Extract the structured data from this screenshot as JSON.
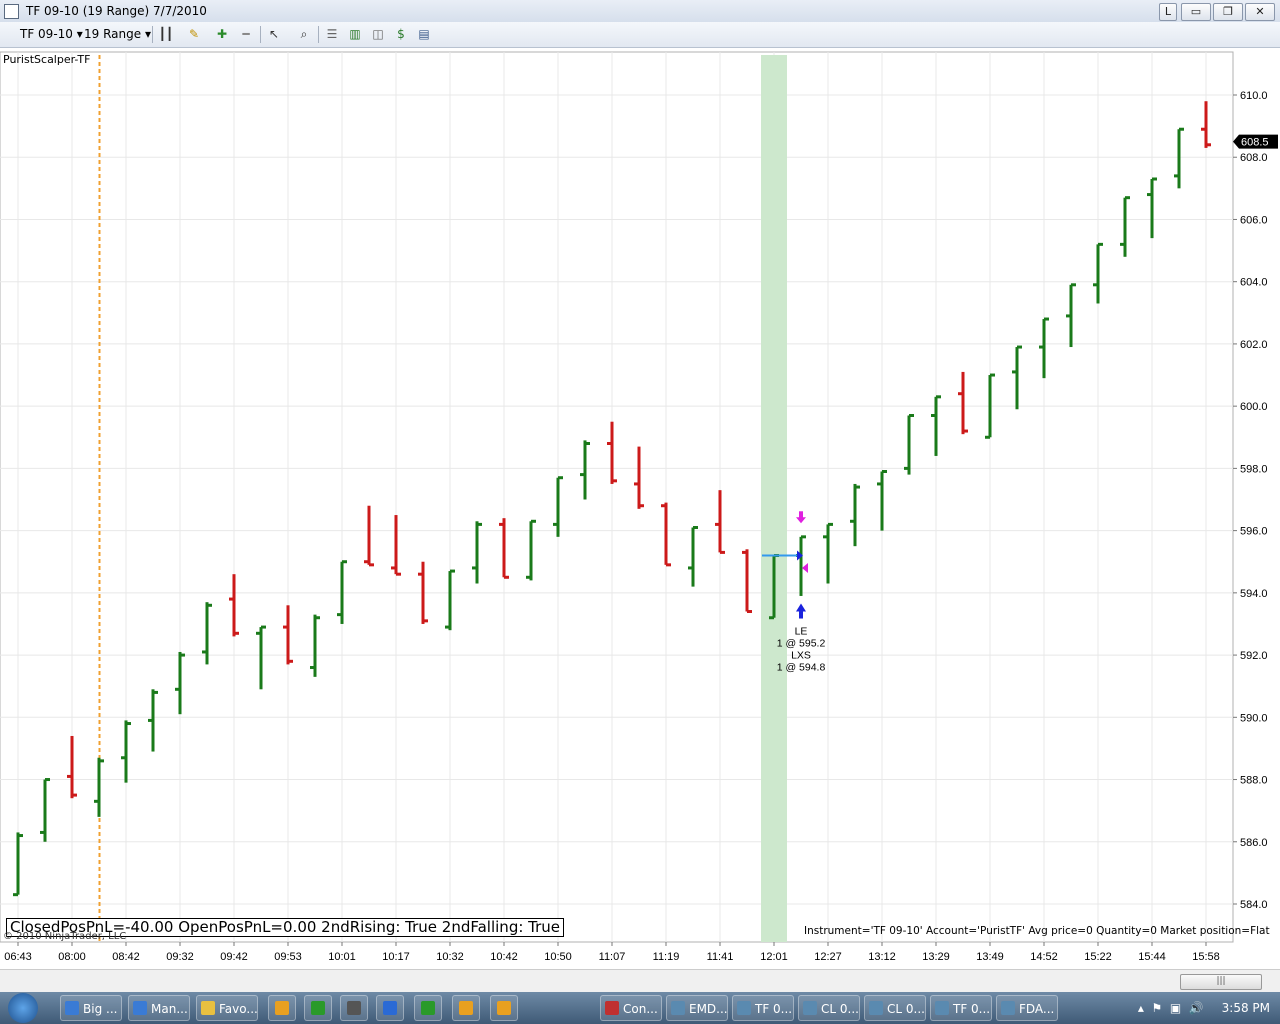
{
  "window": {
    "title": "TF 09-10 (19 Range)  7/7/2010",
    "buttons": [
      "L",
      "▭",
      "❐",
      "✕"
    ]
  },
  "toolbar": {
    "instrument": "TF 09-10",
    "period": "19 Range"
  },
  "pane_label": "PuristScalper-TF",
  "status_text": "ClosedPosPnL=-40.00 OpenPosPnL=0.00 2ndRising: True 2ndFalling: True",
  "copyright": "© 2010 NinjaTrader, LLC",
  "instrument_info": "Instrument='TF 09-10' Account='PuristTF' Avg price=0 Quantity=0 Market position=Flat",
  "colors": {
    "up": "#1a7a1a",
    "down": "#cc1a1a",
    "highlight": "#cde8cd",
    "session_line": "#f0a030",
    "entry_arrow": "#1a22dd",
    "exit_arrow": "#e020e0",
    "fill_line": "#3399ee"
  },
  "chart_data": {
    "type": "ohlc",
    "ylim": [
      583.3,
      611.2
    ],
    "y_ticks": [
      "610.0",
      "608.0",
      "606.0",
      "604.0",
      "602.0",
      "600.0",
      "598.0",
      "596.0",
      "594.0",
      "592.0",
      "590.0",
      "588.0",
      "586.0",
      "584.0"
    ],
    "y_tick_values": [
      610,
      608,
      606,
      604,
      602,
      600,
      598,
      596,
      594,
      592,
      590,
      588,
      586,
      584
    ],
    "last_price": "608.5",
    "x_labels": [
      "06:43",
      "08:00",
      "08:42",
      "09:32",
      "09:42",
      "09:53",
      "10:01",
      "10:17",
      "10:32",
      "10:42",
      "10:50",
      "11:07",
      "11:19",
      "11:41",
      "12:01",
      "12:27",
      "13:12",
      "13:29",
      "13:49",
      "14:52",
      "15:22",
      "15:44",
      "15:58"
    ],
    "bars": [
      {
        "o": 584.3,
        "h": 586.3,
        "l": 584.3,
        "c": 586.2
      },
      {
        "o": 586.3,
        "h": 588.0,
        "l": 586.0,
        "c": 588.0
      },
      {
        "o": 588.1,
        "h": 589.4,
        "l": 587.4,
        "c": 587.5
      },
      {
        "o": 587.3,
        "h": 588.7,
        "l": 586.8,
        "c": 588.6
      },
      {
        "o": 588.7,
        "h": 589.9,
        "l": 587.9,
        "c": 589.8
      },
      {
        "o": 589.9,
        "h": 590.9,
        "l": 588.9,
        "c": 590.8
      },
      {
        "o": 590.9,
        "h": 592.1,
        "l": 590.1,
        "c": 592.0
      },
      {
        "o": 592.1,
        "h": 593.7,
        "l": 591.7,
        "c": 593.6
      },
      {
        "o": 593.8,
        "h": 594.6,
        "l": 592.6,
        "c": 592.7
      },
      {
        "o": 592.7,
        "h": 592.9,
        "l": 590.9,
        "c": 592.9
      },
      {
        "o": 592.9,
        "h": 593.6,
        "l": 591.7,
        "c": 591.8
      },
      {
        "o": 591.6,
        "h": 593.3,
        "l": 591.3,
        "c": 593.2
      },
      {
        "o": 593.3,
        "h": 595.0,
        "l": 593.0,
        "c": 595.0
      },
      {
        "o": 595.0,
        "h": 596.8,
        "l": 594.9,
        "c": 594.9
      },
      {
        "o": 594.8,
        "h": 596.5,
        "l": 594.6,
        "c": 594.6
      },
      {
        "o": 594.6,
        "h": 595.0,
        "l": 593.0,
        "c": 593.1
      },
      {
        "o": 592.9,
        "h": 594.7,
        "l": 592.8,
        "c": 594.7
      },
      {
        "o": 594.8,
        "h": 596.3,
        "l": 594.3,
        "c": 596.2
      },
      {
        "o": 596.2,
        "h": 596.4,
        "l": 594.5,
        "c": 594.5
      },
      {
        "o": 594.5,
        "h": 596.3,
        "l": 594.4,
        "c": 596.3
      },
      {
        "o": 596.2,
        "h": 597.7,
        "l": 595.8,
        "c": 597.7
      },
      {
        "o": 597.8,
        "h": 598.9,
        "l": 597.0,
        "c": 598.8
      },
      {
        "o": 598.8,
        "h": 599.5,
        "l": 597.5,
        "c": 597.6
      },
      {
        "o": 597.5,
        "h": 598.7,
        "l": 596.7,
        "c": 596.8
      },
      {
        "o": 596.8,
        "h": 596.9,
        "l": 594.9,
        "c": 594.9
      },
      {
        "o": 594.8,
        "h": 596.1,
        "l": 594.2,
        "c": 596.1
      },
      {
        "o": 596.2,
        "h": 597.3,
        "l": 595.3,
        "c": 595.3
      },
      {
        "o": 595.3,
        "h": 595.4,
        "l": 593.4,
        "c": 593.4
      },
      {
        "o": 593.2,
        "h": 595.2,
        "l": 593.2,
        "c": 595.2
      },
      {
        "o": 595.2,
        "h": 595.8,
        "l": 593.9,
        "c": 595.8
      },
      {
        "o": 595.8,
        "h": 596.2,
        "l": 594.3,
        "c": 596.2
      },
      {
        "o": 596.3,
        "h": 597.5,
        "l": 595.5,
        "c": 597.4
      },
      {
        "o": 597.5,
        "h": 597.9,
        "l": 596.0,
        "c": 597.9
      },
      {
        "o": 598.0,
        "h": 599.7,
        "l": 597.8,
        "c": 599.7
      },
      {
        "o": 599.7,
        "h": 600.3,
        "l": 598.4,
        "c": 600.3
      },
      {
        "o": 600.4,
        "h": 601.1,
        "l": 599.1,
        "c": 599.2
      },
      {
        "o": 599.0,
        "h": 601.0,
        "l": 599.0,
        "c": 601.0
      },
      {
        "o": 601.1,
        "h": 601.9,
        "l": 599.9,
        "c": 601.9
      },
      {
        "o": 601.9,
        "h": 602.8,
        "l": 600.9,
        "c": 602.8
      },
      {
        "o": 602.9,
        "h": 603.9,
        "l": 601.9,
        "c": 603.9
      },
      {
        "o": 603.9,
        "h": 605.2,
        "l": 603.3,
        "c": 605.2
      },
      {
        "o": 605.2,
        "h": 606.7,
        "l": 604.8,
        "c": 606.7
      },
      {
        "o": 606.8,
        "h": 607.3,
        "l": 605.4,
        "c": 607.3
      },
      {
        "o": 607.4,
        "h": 608.9,
        "l": 607.0,
        "c": 608.9
      },
      {
        "o": 608.9,
        "h": 609.8,
        "l": 608.3,
        "c": 608.4
      }
    ],
    "highlight_bar_index": 28,
    "session_break_after_bar": 3,
    "trade": {
      "entry_label": "LE",
      "entry_fill": "1 @ 595.2",
      "exit_label": "LXS",
      "exit_fill": "1 @ 594.8",
      "entry_price": 595.2,
      "exit_price": 594.8,
      "bar_index": 29
    }
  },
  "taskbar": {
    "items": [
      "Big ...",
      "Man...",
      "Favo...",
      "",
      "",
      "",
      "",
      "",
      "",
      "",
      "Con...",
      "EMD...",
      "TF 0...",
      "CL 0...",
      "CL 0...",
      "TF 0...",
      "FDA..."
    ],
    "clock": "3:58 PM"
  }
}
